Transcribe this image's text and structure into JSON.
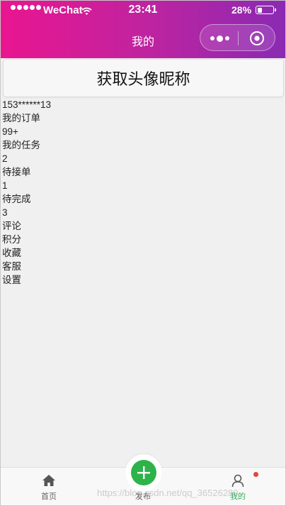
{
  "status_bar": {
    "carrier": "WeChat",
    "time": "23:41",
    "battery_percent_text": "28%",
    "battery_level": 0.28
  },
  "nav": {
    "title": "我的"
  },
  "profile": {
    "nickname_prompt": "获取头像昵称",
    "phone": "153******13"
  },
  "menu": {
    "my_orders_label": "我的订单",
    "my_orders_count": "99+",
    "my_tasks_label": "我的任务",
    "my_tasks_count": "2",
    "pending_accept_label": "待接单",
    "pending_accept_count": "1",
    "pending_complete_label": "待完成",
    "pending_complete_count": "3",
    "reviews_label": "评论",
    "points_label": "积分",
    "favorites_label": "收藏",
    "customer_service_label": "客服",
    "settings_label": "设置"
  },
  "tabbar": {
    "home_label": "首页",
    "publish_label": "发布",
    "mine_label": "我的",
    "active_color": "#3cae5c",
    "publish_color": "#2eb24a"
  },
  "watermark": "https://blog.csdn.net/qq_36526280",
  "colors": {
    "header_gradient_start": "#ea1590",
    "header_gradient_end": "#8a2ab3",
    "badge": "#e0463e"
  },
  "icons": {
    "home": "home-icon",
    "publish": "plus-icon",
    "mine": "user-icon",
    "more": "more-dots-icon",
    "close": "target-close-icon",
    "wifi": "wifi-icon",
    "battery": "battery-icon"
  }
}
